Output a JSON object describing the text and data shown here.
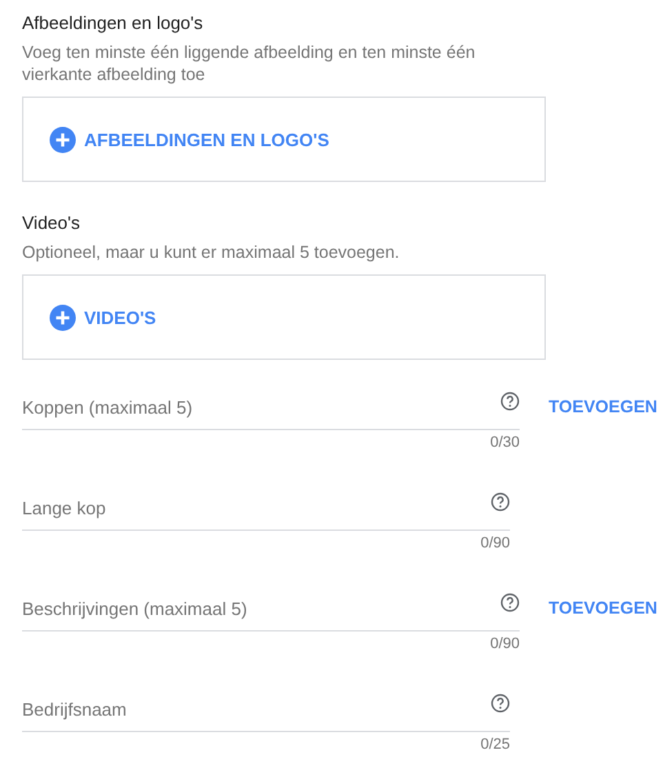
{
  "upload_sections": [
    {
      "title": "Afbeeldingen en logo's",
      "description": "Voeg ten minste één liggende afbeelding en ten minste één vierkante afbeelding toe",
      "button": "AFBEELDINGEN EN LOGO'S"
    },
    {
      "title": "Video's",
      "description": "Optioneel, maar u kunt er maximaal 5 toevoegen.",
      "button": "VIDEO'S"
    }
  ],
  "text_fields": [
    {
      "placeholder": "Koppen (maximaal 5)",
      "counter": "0/30",
      "add_button": "TOEVOEGEN"
    },
    {
      "placeholder": "Lange kop",
      "counter": "0/90"
    },
    {
      "placeholder": "Beschrijvingen (maximaal 5)",
      "counter": "0/90",
      "add_button": "TOEVOEGEN"
    },
    {
      "placeholder": "Bedrijfsnaam",
      "counter": "0/25"
    }
  ]
}
